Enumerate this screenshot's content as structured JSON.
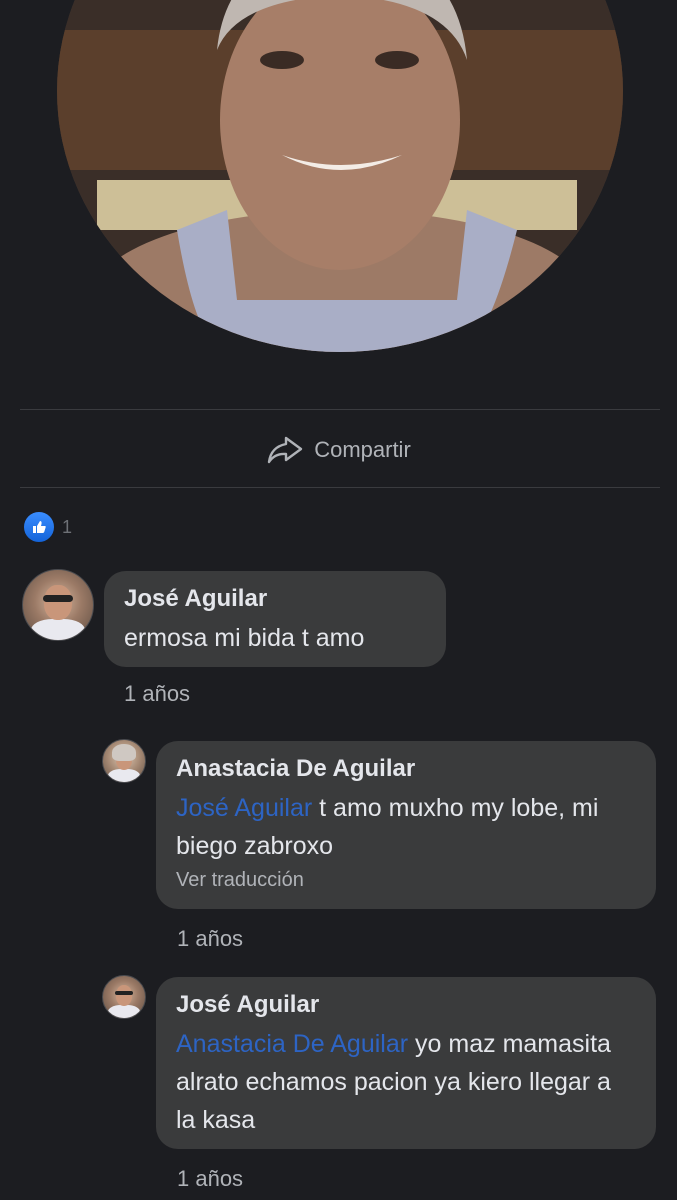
{
  "share": {
    "label": "Compartir",
    "icon": "share-arrow-icon"
  },
  "reactions": {
    "icon": "like-icon",
    "count": "1",
    "color": "#1877f2"
  },
  "comments": [
    {
      "author": "José Aguilar",
      "text": "ermosa mi bida t amo",
      "time": "1 años"
    }
  ],
  "replies": [
    {
      "author": "Anastacia De Aguilar",
      "mention": "José Aguilar",
      "text": " t amo muxho my lobe, mi biego zabroxo",
      "translate": "Ver traducción",
      "time": "1 años"
    },
    {
      "author": "José Aguilar",
      "mention": "Anastacia De Aguilar",
      "text": " yo maz mamasita alrato echamos pacion ya kiero llegar a la kasa",
      "time": "1 años"
    }
  ]
}
